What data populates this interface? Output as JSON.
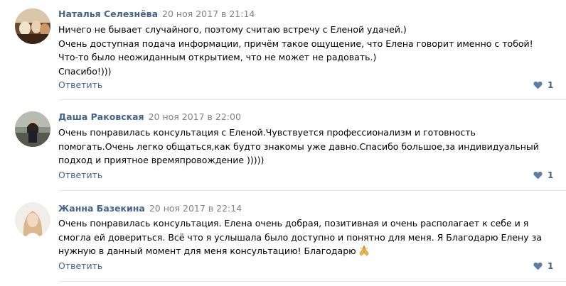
{
  "comments": [
    {
      "author": "Наталья Селезнёва",
      "date": "20 ноя 2017 в 21:14",
      "lines": [
        "Ничего не бывает случайного, поэтому считаю встречу с Еленой удачей.)",
        "Очень доступная подача информации, причём такое ощущение, что Елена говорит именно с тобой! Что-то было неожиданным открытием, что не может не радовать.)",
        "Спасибо!)))"
      ],
      "reply_label": "Ответить",
      "like_count": "1",
      "avatar_icon": "avatar-photo-group"
    },
    {
      "author": "Даша Раковская",
      "date": "20 ноя 2017 в 22:00",
      "lines": [
        "Очень понравилась консультация с Еленой.Чувствуется профессионализм и готовность помогать.Очень легко общаться,как будто знакомы уже давно.Спасибо большое,за индивидуальный подход и приятное времяпровождение )))))"
      ],
      "reply_label": "Ответить",
      "like_count": "1",
      "avatar_icon": "avatar-photo-outdoor"
    },
    {
      "author": "Жанна Базекина",
      "date": "20 ноя 2017 в 22:14",
      "lines": [
        "Очень понравилась консультация. Елена очень добрая, позитивная и очень располагает к себе и я смогла ей довериться. Всё что я услышала было доступно и понятно для меня. Я Благодарю Елену за нужную в данный момент для меня консультацию! Благодарю"
      ],
      "emoji": "folded-hands-icon",
      "reply_label": "Ответить",
      "like_count": "1",
      "avatar_icon": "avatar-photo-portrait"
    }
  ],
  "colors": {
    "author": "#42648b",
    "date": "#828282",
    "link": "#42648b",
    "heart": "#5b7ea6",
    "divider": "#e7e8ec"
  }
}
